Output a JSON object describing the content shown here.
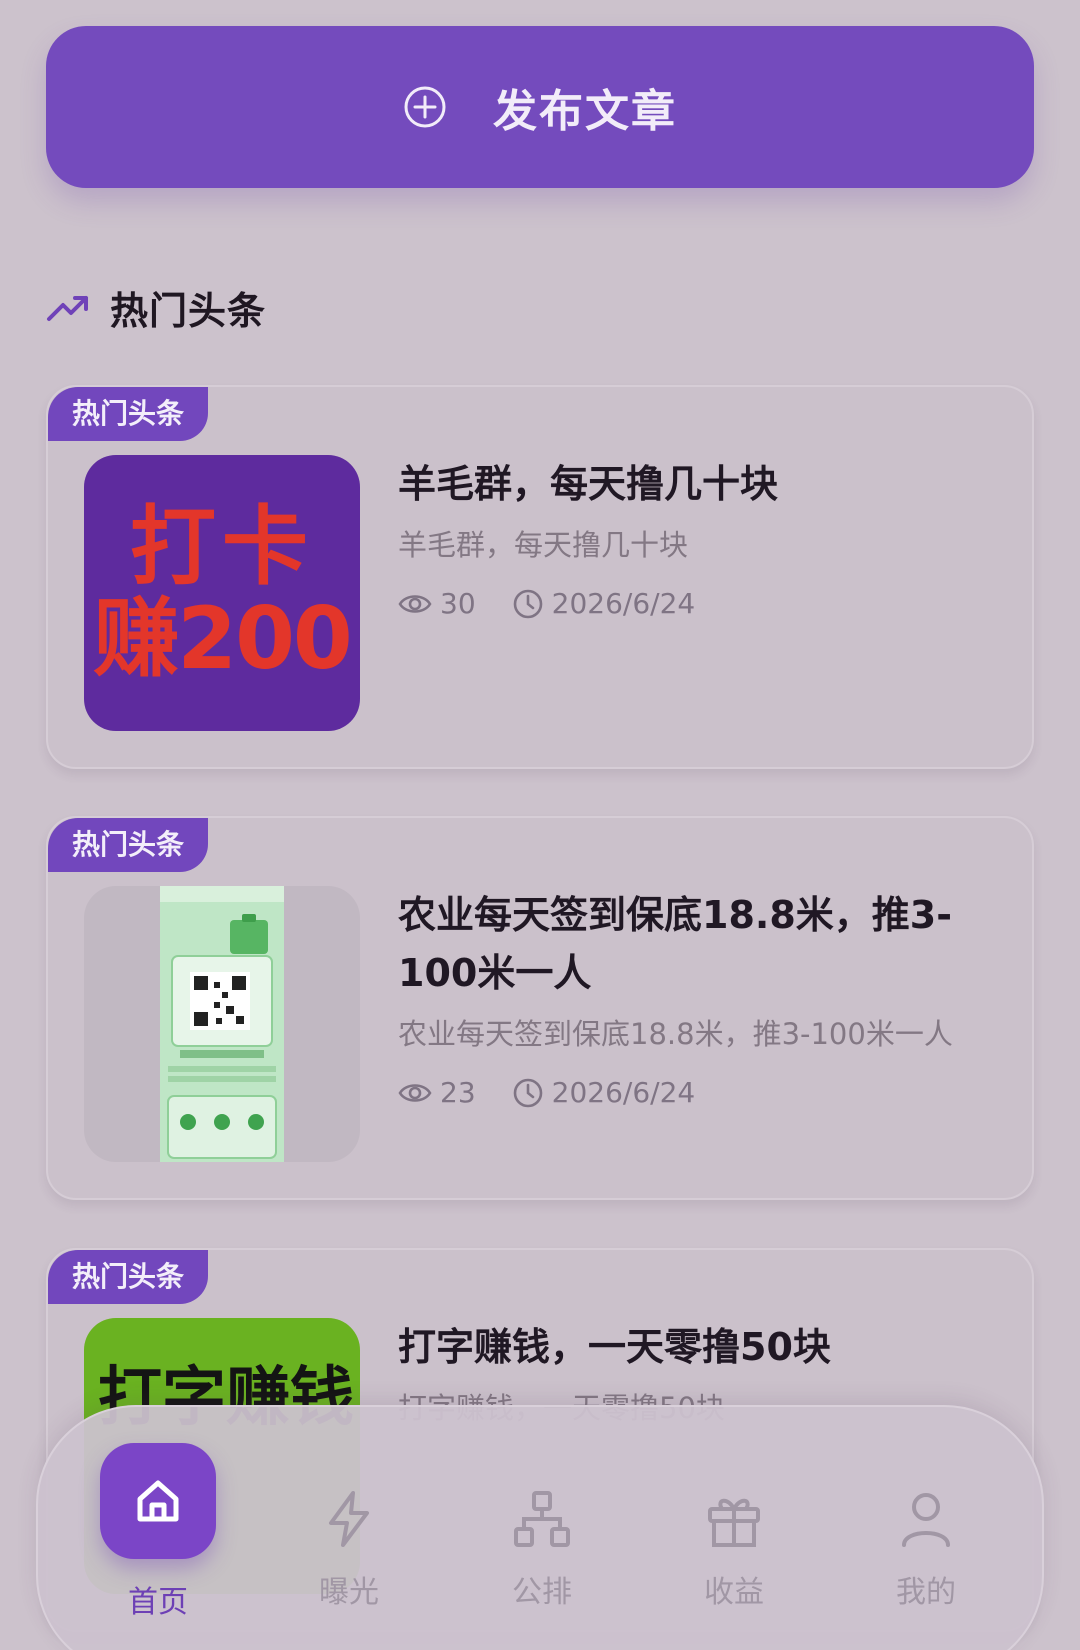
{
  "publish": {
    "label": "发布文章",
    "icon": "plus-circle-icon"
  },
  "section": {
    "title": "热门头条",
    "icon": "trending-up-icon"
  },
  "articles": [
    {
      "tag": "热门头条",
      "title": "羊毛群，每天撸几十块",
      "desc": "羊毛群，每天撸几十块",
      "views": "30",
      "date": "2026/6/24",
      "thumb_line1": "打卡",
      "thumb_line2": "赚200"
    },
    {
      "tag": "热门头条",
      "title": "农业每天签到保底18.8米，推3-100米一人",
      "desc": "农业每天签到保底18.8米，推3-100米一人",
      "views": "23",
      "date": "2026/6/24"
    },
    {
      "tag": "热门头条",
      "title": "打字赚钱，一天零撸50块",
      "desc": "打字赚钱，一天零撸50块",
      "thumb_text": "打字赚钱"
    }
  ],
  "nav": {
    "items": [
      {
        "label": "首页",
        "icon": "home-icon",
        "active": true
      },
      {
        "label": "曝光",
        "icon": "lightning-icon"
      },
      {
        "label": "公排",
        "icon": "hierarchy-icon"
      },
      {
        "label": "收益",
        "icon": "gift-icon"
      },
      {
        "label": "我的",
        "icon": "user-icon"
      }
    ]
  },
  "colors": {
    "accent": "#744bbd",
    "background": "#ccc2cc",
    "thumb_text_red": "#e3362a",
    "thumb_green": "#6ab221"
  }
}
